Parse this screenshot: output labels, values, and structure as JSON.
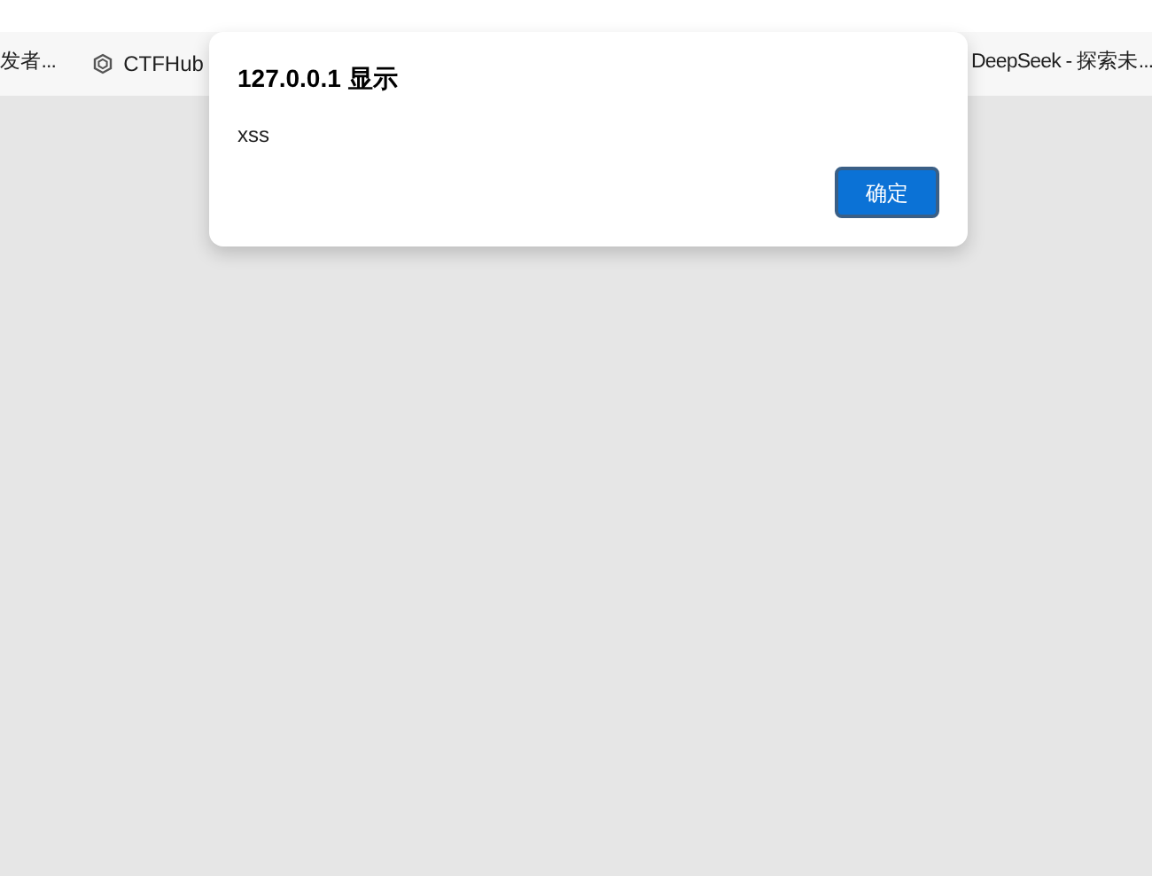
{
  "bookmarks": [
    {
      "label": "发者...",
      "kind": "text"
    },
    {
      "label": "CTFHub",
      "kind": "icon"
    },
    {
      "label": "DeepSeek - 探索未...",
      "kind": "text"
    }
  ],
  "dialog": {
    "title": "127.0.0.1 显示",
    "message": "xss",
    "button": "确定"
  }
}
